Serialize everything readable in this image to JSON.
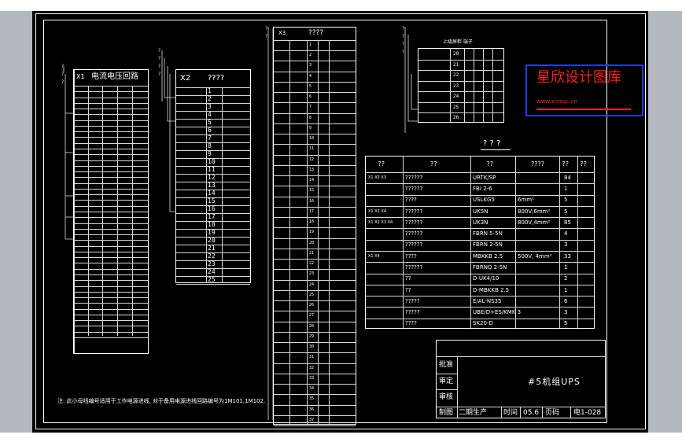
{
  "terminal_x1": {
    "tag": "X1",
    "title": "电流电压回路"
  },
  "terminal_x2": {
    "tag": "X2",
    "title": "????",
    "numbers": [
      "1",
      "2",
      "3",
      "4",
      "5",
      "6",
      "7",
      "8",
      "9",
      "10",
      "11",
      "12",
      "13",
      "14",
      "15",
      "16",
      "17",
      "18",
      "19",
      "20",
      "21",
      "22",
      "23",
      "24",
      "25"
    ]
  },
  "terminal_x3": {
    "tag": "X3",
    "title": "????",
    "numbers": [
      "1",
      "2",
      "3",
      "4",
      "5",
      "6",
      "7",
      "8",
      "9",
      "10",
      "11",
      "12",
      "13",
      "14",
      "15",
      "16",
      "17",
      "18",
      "19",
      "20",
      "21",
      "22",
      "23",
      "24",
      "25",
      "26",
      "27",
      "28",
      "29",
      "30",
      "31",
      "32",
      "33",
      "34",
      "35",
      "36",
      "37"
    ]
  },
  "terminal_small": {
    "title": "上级屏柜 端子",
    "numbers": [
      "20",
      "21",
      "22",
      "23",
      "24",
      "25",
      "26"
    ]
  },
  "watermark": {
    "title": "星欣设计图库",
    "url": "www.xinsqc.cn"
  },
  "parts_list": {
    "title": "? ? ?",
    "headers": [
      "??",
      "??",
      "??",
      "????",
      "??",
      "??"
    ],
    "rows": [
      [
        "X1 X2 X3",
        "??????",
        "URTK/SP",
        "",
        "84",
        ""
      ],
      [
        "",
        "??????",
        "FBI 2-6",
        "",
        "1",
        ""
      ],
      [
        "",
        "????",
        "USLKG5",
        "6mm²",
        "5",
        ""
      ],
      [
        "X1 X2 X4",
        "??????",
        "UK5N",
        "800V,6mm²",
        "5",
        ""
      ],
      [
        "X1 X2 X3 X4",
        "??????",
        "UK3N",
        "800V,4mm²",
        "85",
        ""
      ],
      [
        "",
        "??????",
        "FBRN 5-5N",
        "",
        "4",
        ""
      ],
      [
        "",
        "??????",
        "FBRN 2-5N",
        "",
        "3",
        ""
      ],
      [
        "X1 X4",
        "????",
        "MBKKB 2.5",
        "500V, 4mm²",
        "33",
        ""
      ],
      [
        "",
        "??????",
        "FBRNQ 2-5N",
        "",
        "1",
        ""
      ],
      [
        "",
        "??",
        "D-UK4/10",
        "",
        "2",
        ""
      ],
      [
        "",
        "??",
        "D-MBKKB 2.5",
        "",
        "1",
        ""
      ],
      [
        "",
        "?????",
        "E/AL-NS35",
        "",
        "6",
        ""
      ],
      [
        "",
        "?????",
        "UBE/D+ES/KMK 3",
        "",
        "3",
        ""
      ],
      [
        "",
        "????",
        "SK20-D",
        "",
        "5",
        ""
      ]
    ]
  },
  "title_block": {
    "approve": "批准",
    "review": "审定",
    "check": "审核",
    "draw": "制图",
    "drawer": "二期生产",
    "time_label": "时间",
    "time_value": "05.6",
    "page_label": "页码",
    "drawing_no": "电1-028",
    "title": "#5机组UPS"
  },
  "note": "注: 此小母线编号适用于工作电源进线, 对于备用电源进线回路编号为1M101,1M102."
}
